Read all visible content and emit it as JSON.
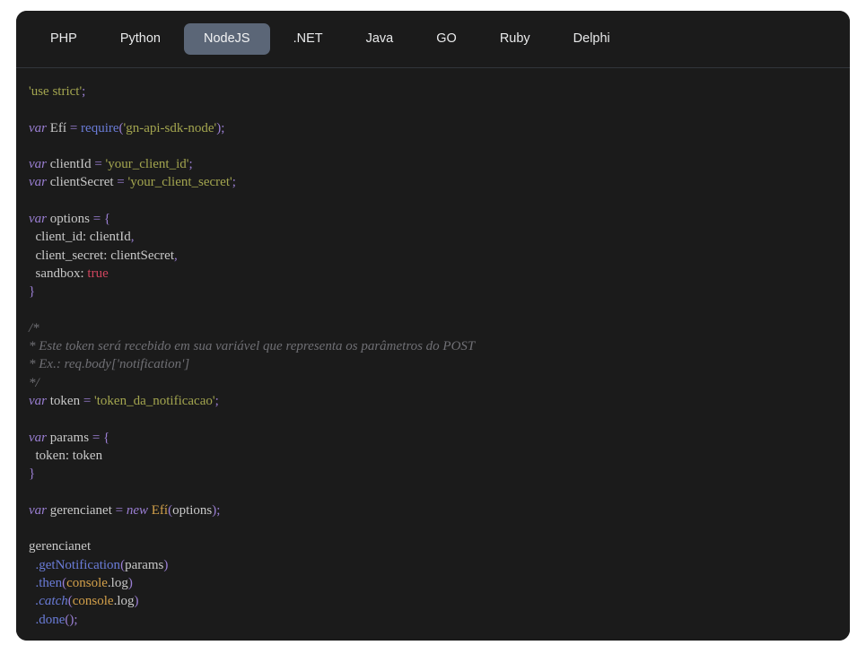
{
  "panel": {
    "background_color": "#1b1b1b",
    "accent_color": "#5b6677"
  },
  "tabbar": {
    "name": "language-tabs",
    "active_index": 2,
    "tabs": [
      {
        "label": "PHP",
        "active": false
      },
      {
        "label": "Python",
        "active": false
      },
      {
        "label": "NodeJS",
        "active": true
      },
      {
        "label": ".NET",
        "active": false
      },
      {
        "label": "Java",
        "active": false
      },
      {
        "label": "GO",
        "active": false
      },
      {
        "label": "Ruby",
        "active": false
      },
      {
        "label": "Delphi",
        "active": false
      }
    ]
  },
  "code": {
    "language": "NodeJS",
    "lines": [
      [
        {
          "t": "'use strict'",
          "c": "str"
        },
        {
          "t": ";",
          "c": "op"
        }
      ],
      [],
      [
        {
          "t": "var",
          "c": "kw"
        },
        {
          "t": " Efí ",
          "c": "plain"
        },
        {
          "t": "=",
          "c": "op"
        },
        {
          "t": " ",
          "c": "plain"
        },
        {
          "t": "require",
          "c": "fn"
        },
        {
          "t": "(",
          "c": "op"
        },
        {
          "t": "'gn-api-sdk-node'",
          "c": "str"
        },
        {
          "t": ");",
          "c": "op"
        }
      ],
      [],
      [
        {
          "t": "var",
          "c": "kw"
        },
        {
          "t": " clientId ",
          "c": "plain"
        },
        {
          "t": "=",
          "c": "op"
        },
        {
          "t": " ",
          "c": "plain"
        },
        {
          "t": "'your_client_id'",
          "c": "str"
        },
        {
          "t": ";",
          "c": "op"
        }
      ],
      [
        {
          "t": "var",
          "c": "kw"
        },
        {
          "t": " clientSecret ",
          "c": "plain"
        },
        {
          "t": "=",
          "c": "op"
        },
        {
          "t": " ",
          "c": "plain"
        },
        {
          "t": "'your_client_secret'",
          "c": "str"
        },
        {
          "t": ";",
          "c": "op"
        }
      ],
      [],
      [
        {
          "t": "var",
          "c": "kw"
        },
        {
          "t": " options ",
          "c": "plain"
        },
        {
          "t": "=",
          "c": "op"
        },
        {
          "t": " ",
          "c": "plain"
        },
        {
          "t": "{",
          "c": "op"
        }
      ],
      [
        {
          "t": "  client_id: clientId",
          "c": "plain"
        },
        {
          "t": ",",
          "c": "op"
        }
      ],
      [
        {
          "t": "  client_secret: clientSecret",
          "c": "plain"
        },
        {
          "t": ",",
          "c": "op"
        }
      ],
      [
        {
          "t": "  sandbox: ",
          "c": "plain"
        },
        {
          "t": "true",
          "c": "bool"
        }
      ],
      [
        {
          "t": "}",
          "c": "op"
        }
      ],
      [],
      [
        {
          "t": "/*",
          "c": "cmt"
        }
      ],
      [
        {
          "t": "* Este token será recebido em sua variável que representa os parâmetros do POST",
          "c": "cmt"
        }
      ],
      [
        {
          "t": "* Ex.: req.body['notification']",
          "c": "cmt"
        }
      ],
      [
        {
          "t": "*/",
          "c": "cmt"
        }
      ],
      [
        {
          "t": "var",
          "c": "kw"
        },
        {
          "t": " token ",
          "c": "plain"
        },
        {
          "t": "=",
          "c": "op"
        },
        {
          "t": " ",
          "c": "plain"
        },
        {
          "t": "'token_da_notificacao'",
          "c": "str"
        },
        {
          "t": ";",
          "c": "op"
        }
      ],
      [],
      [
        {
          "t": "var",
          "c": "kw"
        },
        {
          "t": " params ",
          "c": "plain"
        },
        {
          "t": "=",
          "c": "op"
        },
        {
          "t": " ",
          "c": "plain"
        },
        {
          "t": "{",
          "c": "op"
        }
      ],
      [
        {
          "t": "  token: token",
          "c": "plain"
        }
      ],
      [
        {
          "t": "}",
          "c": "op"
        }
      ],
      [],
      [
        {
          "t": "var",
          "c": "kw"
        },
        {
          "t": " gerencianet ",
          "c": "plain"
        },
        {
          "t": "=",
          "c": "op"
        },
        {
          "t": " ",
          "c": "plain"
        },
        {
          "t": "new",
          "c": "kw"
        },
        {
          "t": " ",
          "c": "plain"
        },
        {
          "t": "Efí",
          "c": "cls"
        },
        {
          "t": "(",
          "c": "op"
        },
        {
          "t": "options",
          "c": "plain"
        },
        {
          "t": ");",
          "c": "op"
        }
      ],
      [],
      [
        {
          "t": "gerencianet",
          "c": "plain"
        }
      ],
      [
        {
          "t": "  ",
          "c": "plain"
        },
        {
          "t": ".getNotification",
          "c": "fn"
        },
        {
          "t": "(",
          "c": "op"
        },
        {
          "t": "params",
          "c": "plain"
        },
        {
          "t": ")",
          "c": "op"
        }
      ],
      [
        {
          "t": "  ",
          "c": "plain"
        },
        {
          "t": ".then",
          "c": "fn"
        },
        {
          "t": "(",
          "c": "op"
        },
        {
          "t": "console",
          "c": "cls"
        },
        {
          "t": ".log",
          "c": "plain"
        },
        {
          "t": ")",
          "c": "op"
        }
      ],
      [
        {
          "t": "  ",
          "c": "plain"
        },
        {
          "t": ".catch",
          "c": "fnk"
        },
        {
          "t": "(",
          "c": "op"
        },
        {
          "t": "console",
          "c": "cls"
        },
        {
          "t": ".log",
          "c": "plain"
        },
        {
          "t": ")",
          "c": "op"
        }
      ],
      [
        {
          "t": "  ",
          "c": "plain"
        },
        {
          "t": ".done",
          "c": "fn"
        },
        {
          "t": "();",
          "c": "op"
        }
      ]
    ]
  }
}
